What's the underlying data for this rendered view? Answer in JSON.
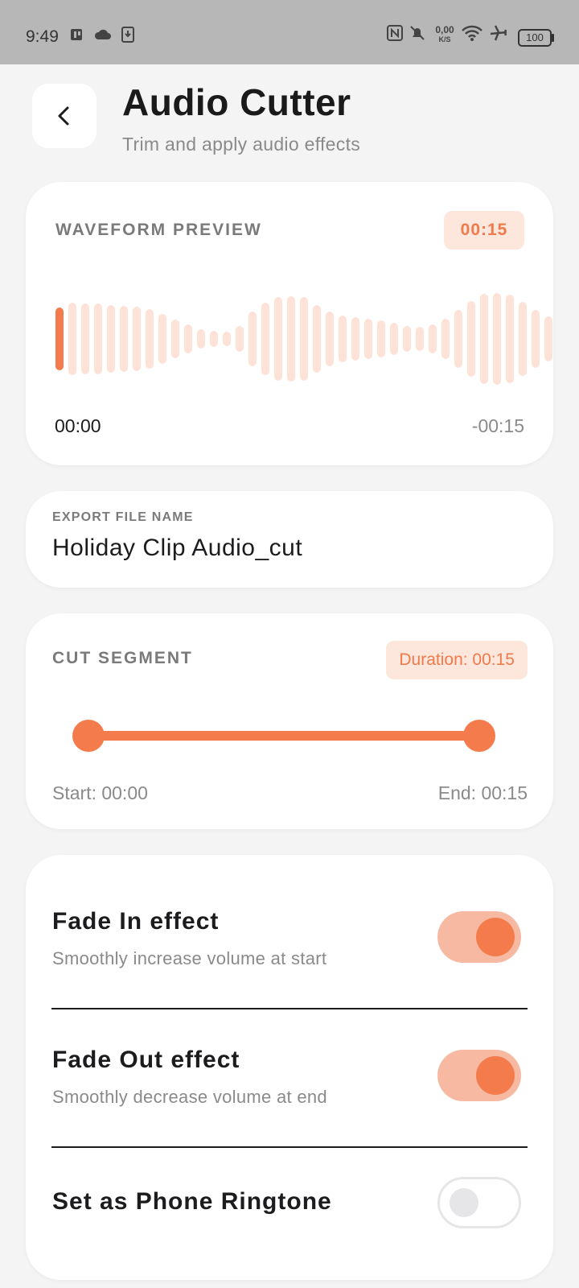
{
  "status_bar": {
    "time": "9:49",
    "network_speed_value": "0,00",
    "network_speed_unit": "K/S",
    "battery": "100"
  },
  "header": {
    "title": "Audio Cutter",
    "subtitle": "Trim and apply audio effects"
  },
  "waveform": {
    "label": "WAVEFORM PREVIEW",
    "time_badge": "00:15",
    "start_time": "00:00",
    "remaining_time": "-00:15",
    "playhead_color": "#f47c4c",
    "bar_color": "#fde3d7"
  },
  "export": {
    "label": "EXPORT FILE NAME",
    "file_name": "Holiday Clip Audio_cut"
  },
  "cut_segment": {
    "label": "CUT SEGMENT",
    "duration_badge": "Duration: 00:15",
    "start_label": "Start: 00:00",
    "end_label": "End: 00:15",
    "range_start_fraction": 0,
    "range_end_fraction": 1
  },
  "effects": [
    {
      "title": "Fade In effect",
      "description": "Smoothly increase volume at start",
      "enabled": true
    },
    {
      "title": "Fade Out effect",
      "description": "Smoothly decrease volume at end",
      "enabled": true
    },
    {
      "title": "Set as Phone Ringtone",
      "description": "",
      "enabled": false
    }
  ],
  "colors": {
    "accent": "#f47c4c",
    "accent_light": "#fde6dc",
    "toggle_track_on": "#f8b9a3",
    "background": "#f4f4f4"
  }
}
